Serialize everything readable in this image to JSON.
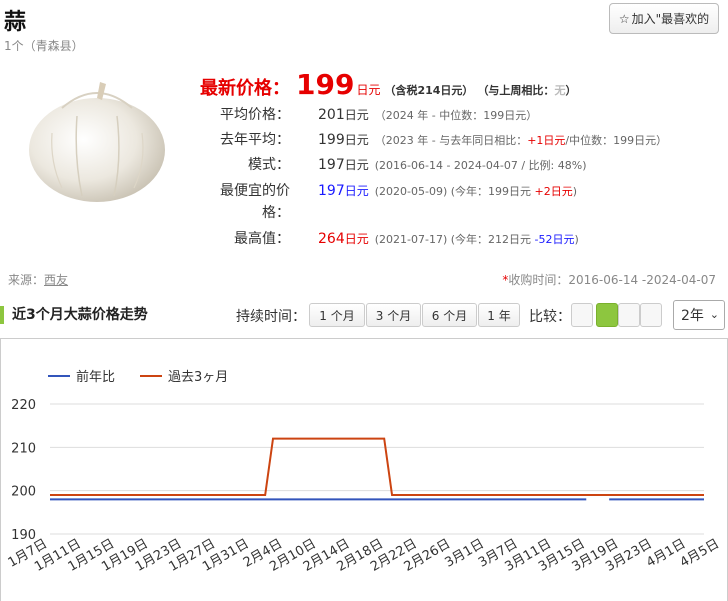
{
  "header": {
    "title": "蒜",
    "subtitle": "1个（青森县）",
    "favorite_label": "加入\"最喜欢的"
  },
  "price": {
    "latest_label": "最新价格：",
    "latest_value": "199",
    "latest_unit": "日元",
    "latest_tax": "（含税214日元）",
    "compare_prefix": "（与上周相比：",
    "compare_value": "无",
    "compare_suffix": "）",
    "rows": [
      {
        "label": "平均价格：",
        "value": "201",
        "unit": "日元",
        "note": "（2024 年 - 中位数：199日元）"
      },
      {
        "label": "去年平均：",
        "value": "199",
        "unit": "日元",
        "note_a": "（2023 年 - 与去年同日相比：",
        "diff": "+1日元",
        "note_b": "/中位数：199日元）"
      },
      {
        "label": "模式：",
        "value": "197",
        "unit": "日元",
        "note": "(2016-06-14 - 2024-04-07 / 比例: 48%)"
      },
      {
        "label_1": "最便宜的价",
        "label_2": "格：",
        "value": "197",
        "unit": "日元",
        "note_a": "(2020-05-09) (今年：199日元 ",
        "diff": "+2日元",
        "note_b": ")"
      },
      {
        "label": "最高值：",
        "value": "264",
        "unit": "日元",
        "note_a": "(2021-07-17) (今年：212日元 ",
        "diff": "-52日元",
        "note_b": ")"
      }
    ]
  },
  "source": {
    "label": "来源：",
    "link": "西友",
    "period_star": "*",
    "period": "收购时间：2016-06-14 -2024-04-07"
  },
  "trend": {
    "title": "近3个月大蒜价格走势",
    "duration_label": "持续时间：",
    "buttons": [
      "1 个月",
      "3 个月",
      "6 个月",
      "1 年"
    ],
    "compare_label": "比较：",
    "compare_boxes": [
      false,
      true,
      false,
      false
    ],
    "year_value": "2年"
  },
  "colors": {
    "accent_red": "#e60000",
    "accent_green": "#8dc63f",
    "series_prev": "#3355bb",
    "series_3m": "#cc4411"
  },
  "chart_data": {
    "type": "line",
    "legend": [
      {
        "name": "前年比",
        "color": "#3355bb"
      },
      {
        "name": "過去3ヶ月",
        "color": "#cc4411"
      }
    ],
    "ylim": [
      190,
      220
    ],
    "yticks": [
      190,
      200,
      210,
      220
    ],
    "x_labels": [
      "1月7日",
      "1月11日",
      "1月15日",
      "1月19日",
      "1月23日",
      "1月27日",
      "1月31日",
      "2月4日",
      "2月10日",
      "2月14日",
      "2月18日",
      "2月22日",
      "2月26日",
      "3月1日",
      "3月7日",
      "3月11日",
      "3月15日",
      "3月19日",
      "3月23日",
      "4月1日",
      "4月5日"
    ],
    "series": [
      {
        "name": "前年比",
        "segments": [
          [
            [
              0,
              198
            ],
            [
              0.82,
              198
            ]
          ],
          [
            [
              0.855,
              198
            ],
            [
              1,
              198
            ]
          ]
        ]
      },
      {
        "name": "過去3ヶ月",
        "points": [
          [
            0,
            199
          ],
          [
            0.329,
            199
          ],
          [
            0.341,
            212
          ],
          [
            0.511,
            212
          ],
          [
            0.523,
            199
          ],
          [
            0.855,
            199
          ],
          [
            0.875,
            199
          ],
          [
            1,
            199
          ]
        ]
      }
    ]
  }
}
